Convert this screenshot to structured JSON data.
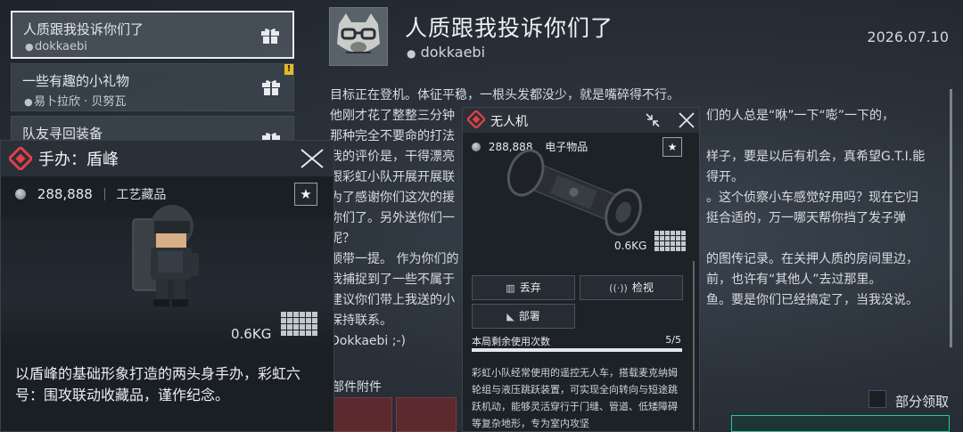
{
  "mail_list": {
    "items": [
      {
        "title": "人质跟我投诉你们了",
        "sender": "dokkaebi",
        "selected": true,
        "new_badge": ""
      },
      {
        "title": "一些有趣的小礼物",
        "sender": "易卜拉欣 · 贝努瓦",
        "selected": false,
        "new_badge": "!"
      },
      {
        "title": "队友寻回装备",
        "sender": "",
        "selected": false,
        "new_badge": ""
      }
    ]
  },
  "mail": {
    "title": "人质跟我投诉你们了",
    "from": "dokkaebi",
    "date": "2026.07.10",
    "body_lines": [
      "目标正在登机。体征平稳，一根头发都没少，就是嘴碎得不行。",
      "他刚才花了整整三分钟",
      "那种完全不要命的打法",
      "我的评价是，干得漂亮",
      "跟彩虹小队开展开展联",
      "为了感谢你们这次的援",
      "你们了。另外送你们一",
      "呢？",
      "顺带一提。 作为你们的",
      "我捕捉到了一些不属于",
      "建议你们带上我送的小",
      "保持联系。",
      "Dokkaebi ;-)"
    ],
    "body_lines_right": [
      "",
      "们的人总是“咻”一下“嘭”一下的，",
      "",
      "样子，要是以后有机会，真希望G.T.I.能",
      "得开。",
      "。这个侦察小车感觉好用吗？现在它归",
      "挺合适的，万一哪天帮你挡了发子弹",
      "",
      "的图传记录。在关押人质的房间里边，",
      "前，也许有“其他人”去过那里。",
      "鱼。要是你们已经搞定了，当我没说。",
      "",
      ""
    ],
    "attachments_label": "部件附件",
    "partial_claim_label": "部分领取"
  },
  "popup_figure": {
    "title": "手办：盾峰",
    "price": "288,888",
    "category": "工艺藏品",
    "weight": "0.6KG",
    "favorite_glyph": "★",
    "description": "以盾峰的基础形象打造的两头身手办，彩虹六号：围攻联动收藏品，谨作纪念。"
  },
  "popup_drone": {
    "title": "无人机",
    "price": "288,888",
    "category": "电子物品",
    "weight": "0.6KG",
    "favorite_glyph": "★",
    "buttons": {
      "discard": "丢弃",
      "inspect": "检视",
      "deploy": "部署"
    },
    "uses_label": "本局剩余使用次数",
    "uses_count": "5/5",
    "uses_fraction": 1.0,
    "description": "彩虹小队经常使用的遥控无人车，搭载麦克纳姆轮组与液压跳跃装置，可实现全向转向与短途跳跃机动，能够灵活穿行于门缝、管道、低矮障碍等复杂地形，专为室内攻坚"
  },
  "colors": {
    "accent_red": "#e0404a",
    "claim_green": "#2fc79a",
    "badge_yellow": "#e4b92c"
  },
  "icons": [
    "gift-icon",
    "person-icon",
    "close-icon",
    "star-icon",
    "coin-icon",
    "diamond-logo-icon",
    "collapse-icon",
    "trash-icon",
    "inspect-icon",
    "deploy-icon",
    "grid-size-icon"
  ]
}
